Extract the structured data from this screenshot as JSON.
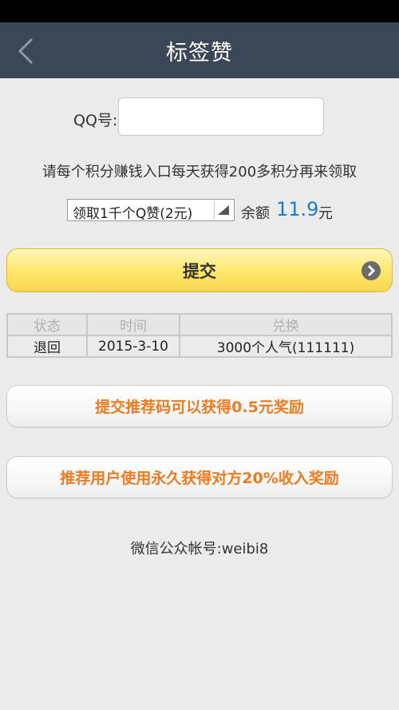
{
  "header": {
    "title": "标签赞",
    "back_icon": "chevron-left-icon"
  },
  "form": {
    "qq_label": "QQ号:",
    "qq_value": "",
    "qq_placeholder": ""
  },
  "hint": "请每个积分赚钱入口每天获得200多积分再来领取",
  "package_select": {
    "selected": "领取1千个Q赞(2元)",
    "arrow_icon": "dropdown-triangle-icon"
  },
  "balance": {
    "label": "余额",
    "value": "11.9",
    "unit": "元",
    "color": "#1f78d1"
  },
  "submit": {
    "label": "提交",
    "icon": "circle-chevron-right-icon",
    "accent": "#ffe56a"
  },
  "history": {
    "headers": [
      "状态",
      "时间",
      "兑换"
    ],
    "rows": [
      [
        "退回",
        "2015-3-10",
        "3000个人气(111111)"
      ]
    ]
  },
  "promos": [
    "提交推荐码可以获得0.5元奖励",
    "推荐用户使用永久获得对方20%收入奖励"
  ],
  "promo_color": "#ef7a1f",
  "footer": "微信公众帐号:weibi8"
}
